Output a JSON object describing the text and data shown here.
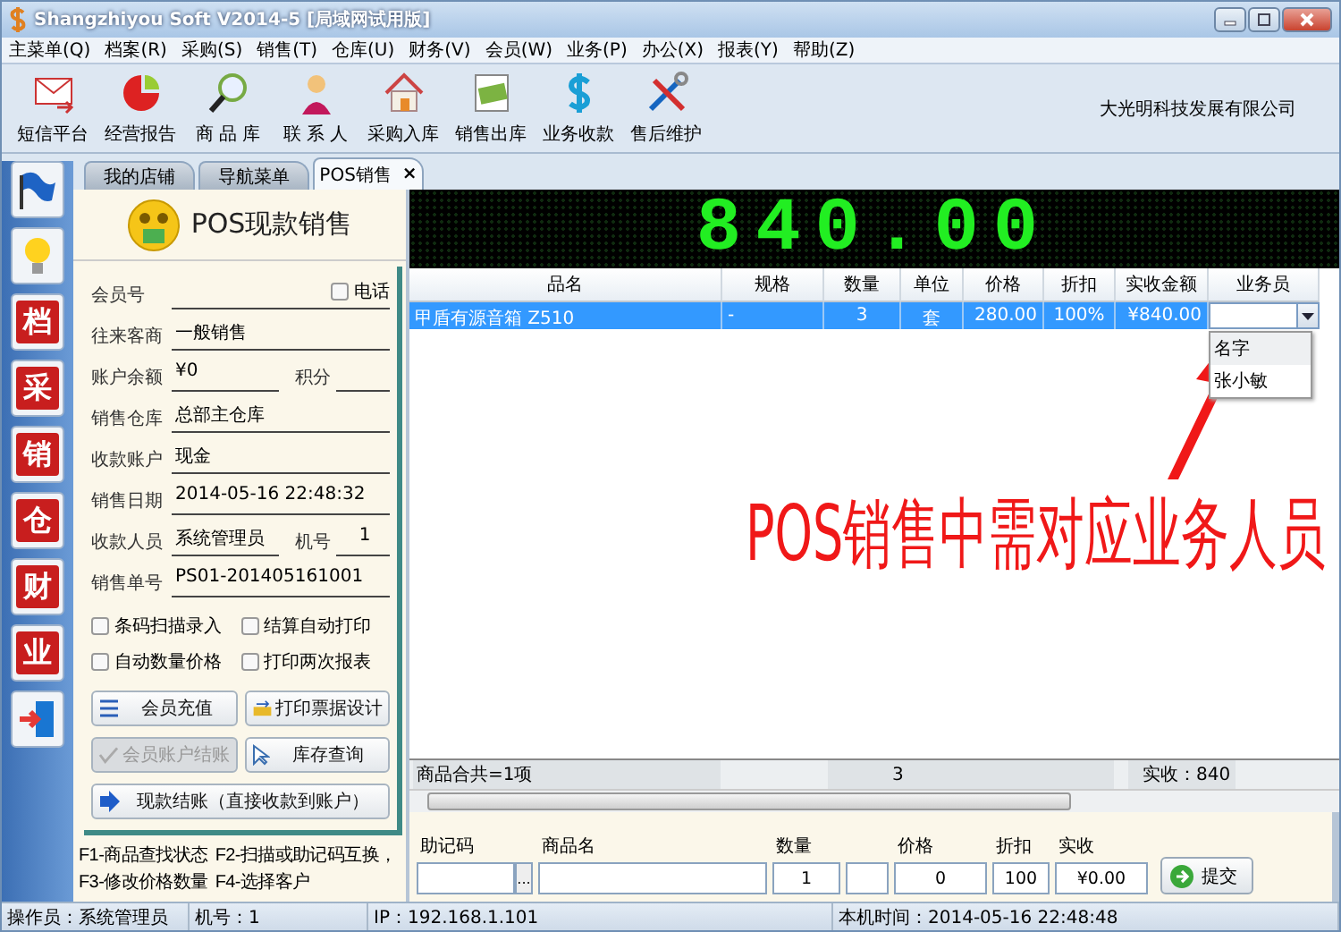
{
  "window": {
    "title": "Shangzhiyou Soft V2014-5 [局域网试用版]"
  },
  "menu": [
    "主菜单(Q)",
    "档案(R)",
    "采购(S)",
    "销售(T)",
    "仓库(U)",
    "财务(V)",
    "会员(W)",
    "业务(P)",
    "办公(X)",
    "报表(Y)",
    "帮助(Z)"
  ],
  "toolbar": {
    "items": [
      {
        "kind": "mail",
        "label": "短信平台"
      },
      {
        "kind": "pie",
        "label": "经营报告"
      },
      {
        "kind": "magnifier",
        "label": "商 品 库"
      },
      {
        "kind": "person",
        "label": "联 系 人"
      },
      {
        "kind": "house",
        "label": "采购入库"
      },
      {
        "kind": "money",
        "label": "销售出库"
      },
      {
        "kind": "dollar",
        "label": "业务收款"
      },
      {
        "kind": "tools",
        "label": "售后维护"
      }
    ],
    "company": "大光明科技发展有限公司"
  },
  "tabs": [
    {
      "label": "我的店铺",
      "selected": false
    },
    {
      "label": "导航菜单",
      "selected": false
    },
    {
      "label": "POS销售",
      "selected": true,
      "close": "×"
    }
  ],
  "sidebar": [
    {
      "kind": "flag"
    },
    {
      "kind": "bulb"
    },
    {
      "kind": "char",
      "label": "档"
    },
    {
      "kind": "char",
      "label": "采"
    },
    {
      "kind": "char",
      "label": "销"
    },
    {
      "kind": "char",
      "label": "仓"
    },
    {
      "kind": "char",
      "label": "财"
    },
    {
      "kind": "char",
      "label": "业"
    },
    {
      "kind": "exit"
    }
  ],
  "pos_panel": {
    "title": "POS现款销售",
    "fields": [
      {
        "label": "会员号",
        "checkbox": {
          "label": "电话",
          "checked": false
        }
      },
      {
        "label": "往来客商",
        "value": "一般销售"
      },
      {
        "label": "账户余额",
        "value": "¥0",
        "second": {
          "label": "积分"
        }
      },
      {
        "label": "销售仓库",
        "value": "总部主仓库"
      },
      {
        "label": "收款账户",
        "value": "现金"
      },
      {
        "label": "销售日期",
        "value": "2014-05-16 22:48:32"
      },
      {
        "label": "收款人员",
        "value": "系统管理员",
        "second": {
          "label": "机号",
          "value": "1"
        }
      },
      {
        "label": "销售单号",
        "value": "PS01-201405161001"
      }
    ],
    "options": [
      {
        "label": "条码扫描录入",
        "checked": false
      },
      {
        "label": "结算自动打印",
        "checked": false
      },
      {
        "label": "自动数量价格",
        "checked": false
      },
      {
        "label": "打印两次报表",
        "checked": false
      }
    ],
    "buttons": [
      {
        "kind": "list",
        "label": "会员充值",
        "disabled": false
      },
      {
        "kind": "print",
        "label": "打印票据设计",
        "disabled": false
      },
      {
        "kind": "check",
        "label": "会员账户结账",
        "disabled": true
      },
      {
        "kind": "cursor",
        "label": "库存查询",
        "disabled": false
      },
      {
        "kind": "arrow",
        "label": "现款结账（直接收款到账户）",
        "disabled": false
      }
    ],
    "hints": [
      "F1-商品查找状态",
      "F2-扫描或助记码互换，",
      "F3-修改价格数量",
      "F4-选择客户"
    ]
  },
  "display": "840.00",
  "table": {
    "columns": [
      "品名",
      "规格",
      "数量",
      "单位",
      "价格",
      "折扣",
      "实收金额",
      "业务员"
    ],
    "rows": [
      {
        "cells": [
          "甲盾有源音箱 Z510",
          "-",
          "3",
          "套",
          "280.00",
          "100%",
          "¥840.00"
        ],
        "selected": true
      }
    ],
    "dropdown": {
      "expanded": true,
      "options": [
        "名字",
        "张小敏"
      ]
    }
  },
  "summary": [
    "商品合共=1项",
    "3",
    "实收：840"
  ],
  "entry": {
    "fields": [
      {
        "kind": "code",
        "label": "助记码",
        "browse": "..."
      },
      {
        "kind": "name",
        "label": "商品名"
      },
      {
        "kind": "qty",
        "label": "数量",
        "value": "1"
      },
      {
        "kind": "unit"
      },
      {
        "kind": "price",
        "label": "价格",
        "value": "0"
      },
      {
        "kind": "discount",
        "label": "折扣",
        "value": "100"
      },
      {
        "kind": "paid",
        "label": "实收",
        "value": "¥0.00"
      }
    ],
    "submit": "提交"
  },
  "annotation": "POS销售中需对应业务人员",
  "status_bar": [
    "操作员：系统管理员",
    "机号：1",
    "IP：192.168.1.101",
    "本机时间：2014-05-16 22:48:48"
  ]
}
